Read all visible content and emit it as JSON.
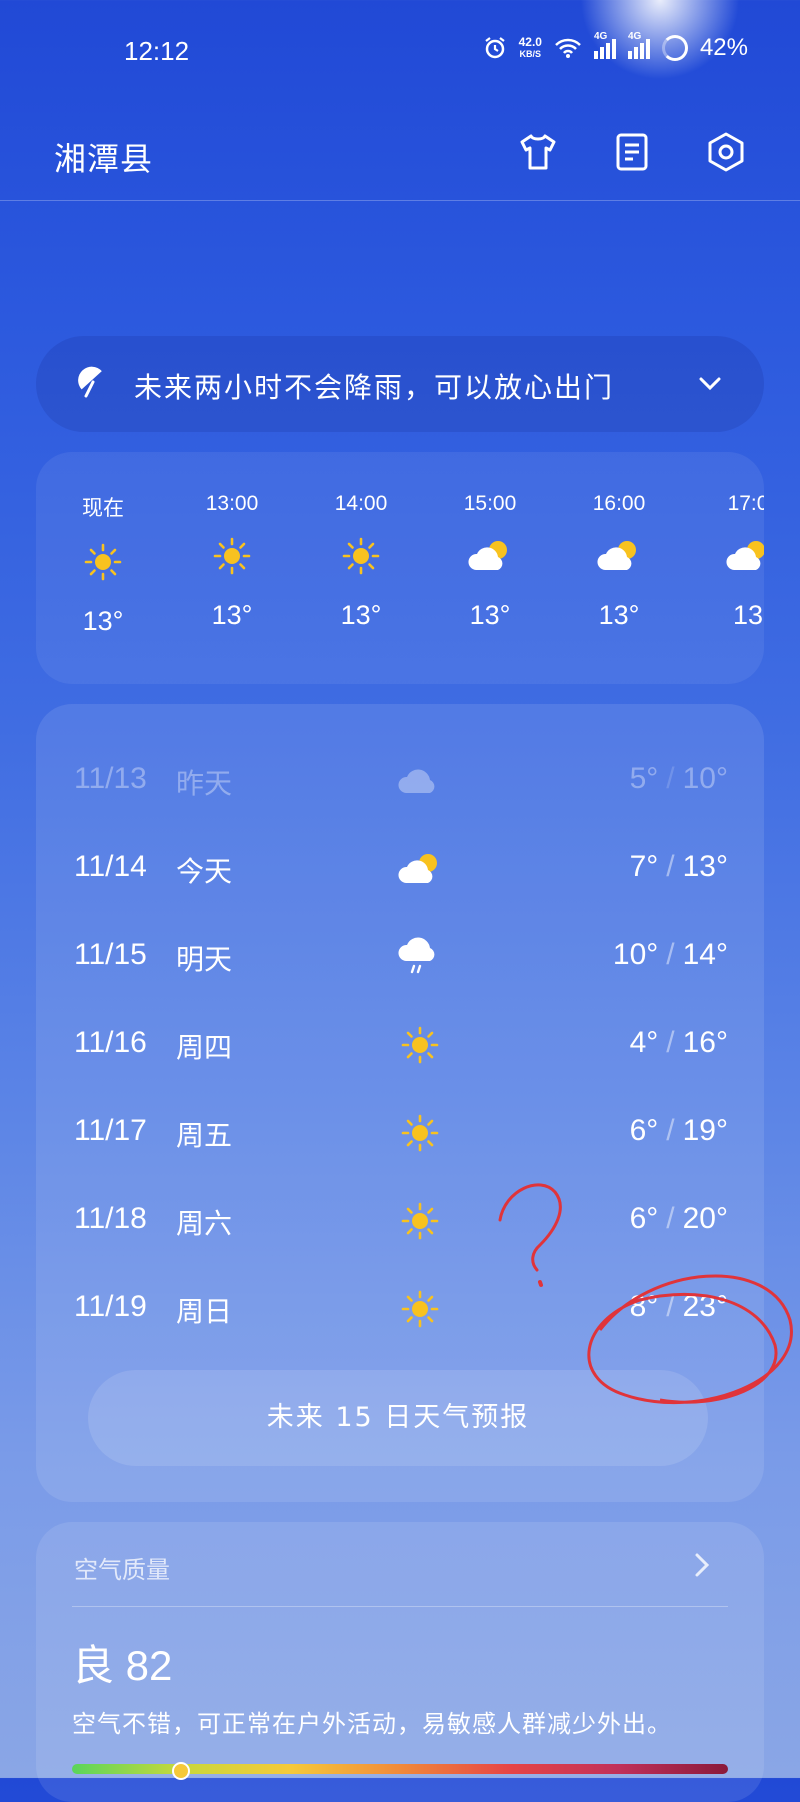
{
  "status": {
    "time": "12:12",
    "net_speed": "42.0",
    "net_unit": "KB/S",
    "sig1": "4G",
    "sig2": "4G",
    "battery": "42%"
  },
  "header": {
    "city": "湘潭县"
  },
  "rain": {
    "text": "未来两小时不会降雨，可以放心出门"
  },
  "hourly": [
    {
      "label": "现在",
      "icon": "sun-icon",
      "temp": "13°"
    },
    {
      "label": "13:00",
      "icon": "sun-icon",
      "temp": "13°"
    },
    {
      "label": "14:00",
      "icon": "sun-icon",
      "temp": "13°"
    },
    {
      "label": "15:00",
      "icon": "partly-cloudy-icon",
      "temp": "13°"
    },
    {
      "label": "16:00",
      "icon": "partly-cloudy-icon",
      "temp": "13°"
    },
    {
      "label": "17:0",
      "icon": "partly-cloudy-icon",
      "temp": "13"
    }
  ],
  "daily": [
    {
      "date": "11/13",
      "weekday": "昨天",
      "icon": "cloud-icon",
      "low": "5°",
      "high": "10°",
      "sep": "/"
    },
    {
      "date": "11/14",
      "weekday": "今天",
      "icon": "partly-cloudy-icon",
      "low": "7°",
      "high": "13°",
      "sep": "/"
    },
    {
      "date": "11/15",
      "weekday": "明天",
      "icon": "rain-icon",
      "low": "10°",
      "high": "14°",
      "sep": "/"
    },
    {
      "date": "11/16",
      "weekday": "周四",
      "icon": "sun-icon",
      "low": "4°",
      "high": "16°",
      "sep": "/"
    },
    {
      "date": "11/17",
      "weekday": "周五",
      "icon": "sun-icon",
      "low": "6°",
      "high": "19°",
      "sep": "/"
    },
    {
      "date": "11/18",
      "weekday": "周六",
      "icon": "sun-icon",
      "low": "6°",
      "high": "20°",
      "sep": "/"
    },
    {
      "date": "11/19",
      "weekday": "周日",
      "icon": "sun-icon",
      "low": "8°",
      "high": "23°",
      "sep": "/"
    }
  ],
  "forecast_button": "未来 15 日天气预报",
  "air": {
    "title": "空气质量",
    "value": "良 82",
    "desc": "空气不错，可正常在户外活动，易敏感人群减少外出。",
    "aqi_level": 82
  },
  "colors": {
    "sun": "#f8c21f",
    "annotation": "#e0343a"
  }
}
